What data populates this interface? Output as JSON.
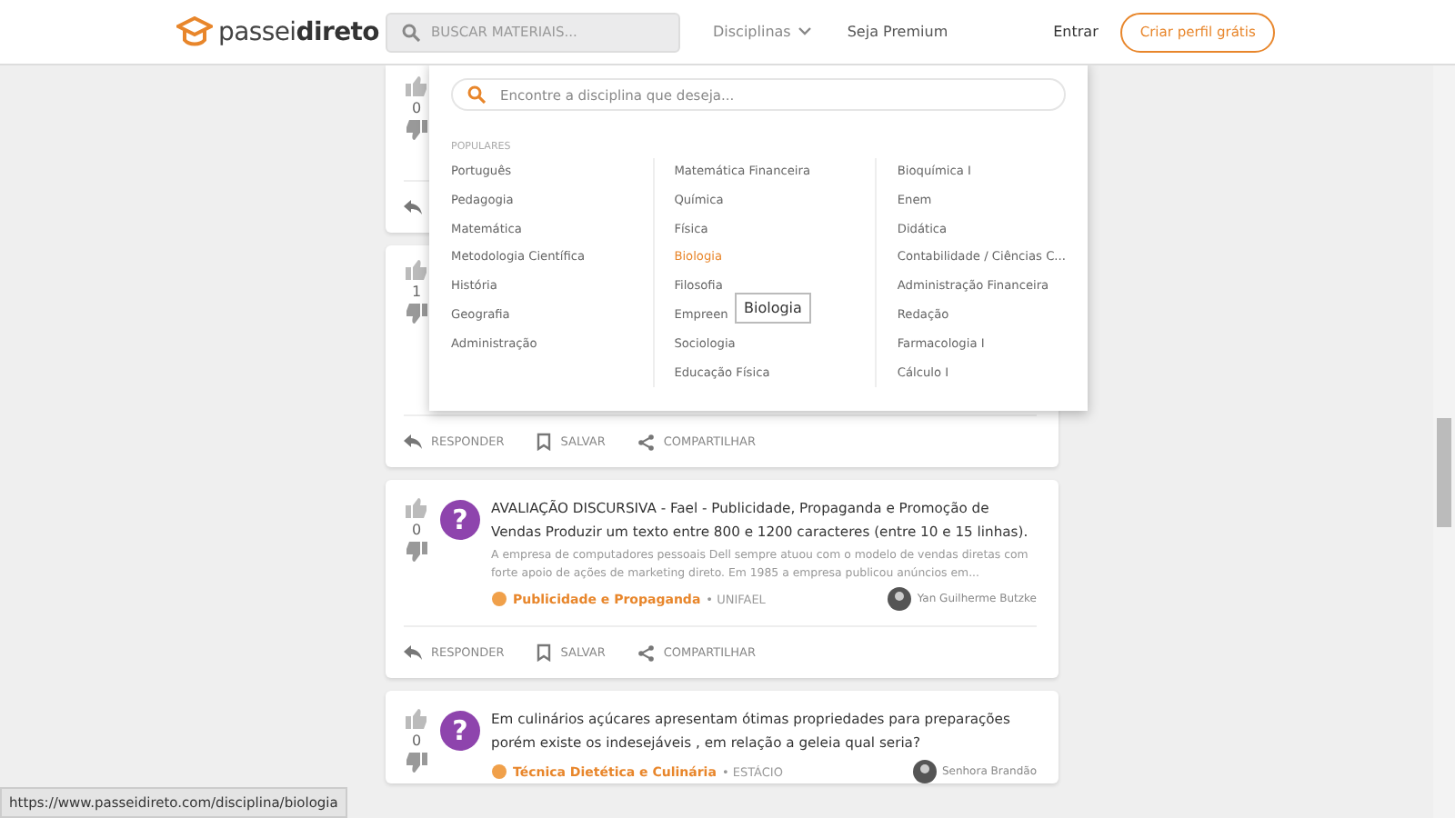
{
  "header": {
    "logo": {
      "light": "passei",
      "bold": "direto"
    },
    "search": {
      "placeholder": "BUSCAR MATERIAIS..."
    },
    "nav": [
      {
        "label": "Disciplinas",
        "kind": "dropdown",
        "expanded": true
      },
      {
        "label": "Seja Premium",
        "kind": "link",
        "expanded": false
      }
    ],
    "login": "Entrar",
    "cta": "Criar perfil grátis"
  },
  "feed": [
    {
      "votes": "0"
    },
    {
      "votes": "1",
      "actions": [
        "RESPONDER",
        "SALVAR",
        "COMPARTILHAR"
      ]
    },
    {
      "votes": "0",
      "badge": "?",
      "title": "AVALIAÇÃO DISCURSIVA - Fael - Publicidade, Propaganda e Promoção de Vendas Produzir um texto entre 800 e 1200 caracteres (entre 10 e 15 linhas).",
      "excerpt": "A empresa de computadores pessoais Dell sempre atuou com o modelo de vendas diretas com forte apoio de ações de marketing direto. Em 1985 a empresa publicou anúncios em...",
      "tag": "Publicidade e Propaganda",
      "school": "• UNIFAEL",
      "author": "Yan Guilherme Butzke",
      "actions": [
        "RESPONDER",
        "SALVAR",
        "COMPARTILHAR"
      ]
    },
    {
      "votes": "0",
      "badge": "?",
      "title": "Em culinários açúcares apresentam ótimas propriedades para preparações porém existe os indesejáveis , em relação a geleia qual seria?",
      "tag": "Técnica Dietética e Culinária",
      "school": "• ESTÁCIO",
      "author": "Senhora Brandão"
    }
  ],
  "dropdown": {
    "search": {
      "placeholder": "Encontre a disciplina que deseja..."
    },
    "section": "POPULARES",
    "columns": [
      [
        {
          "label": "Português",
          "selected": false
        },
        {
          "label": "Pedagogia",
          "selected": false
        },
        {
          "label": "Matemática",
          "selected": false
        },
        {
          "label": "Metodologia Científica",
          "selected": false
        },
        {
          "label": "História",
          "selected": false
        },
        {
          "label": "Geografia",
          "selected": false
        },
        {
          "label": "Administração",
          "selected": false
        }
      ],
      [
        {
          "label": "Matemática Financeira",
          "selected": false
        },
        {
          "label": "Química",
          "selected": false
        },
        {
          "label": "Física",
          "selected": false
        },
        {
          "label": "Biologia",
          "selected": true
        },
        {
          "label": "Filosofia",
          "selected": false
        },
        {
          "label": "Empreen",
          "selected": false
        },
        {
          "label": "Sociologia",
          "selected": false
        },
        {
          "label": "Educação Física",
          "selected": false
        }
      ],
      [
        {
          "label": "Bioquímica I",
          "selected": false
        },
        {
          "label": "Enem",
          "selected": false
        },
        {
          "label": "Didática",
          "selected": false
        },
        {
          "label": "Contabilidade / Ciências C...",
          "selected": false
        },
        {
          "label": "Administração Financeira",
          "selected": false
        },
        {
          "label": "Redação",
          "selected": false
        },
        {
          "label": "Farmacologia I",
          "selected": false
        },
        {
          "label": "Cálculo I",
          "selected": false
        }
      ]
    ],
    "tooltip": "Biologia"
  },
  "status_url": "https://www.passeidireto.com/disciplina/biologia"
}
